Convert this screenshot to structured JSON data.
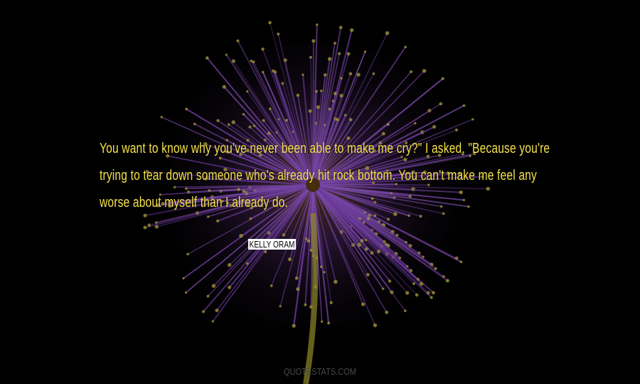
{
  "quote": {
    "text": "You want to know why you've never been able to make me cry?\" I asked. \"Because you're trying to tear down someone who's already hit rock bottom. You can't make me feel any worse about myself than I already do."
  },
  "author": {
    "name": "KELLY ORAM"
  },
  "footer": {
    "site": "QUOTESTATS.COM"
  },
  "colors": {
    "background": "#000000",
    "quote_text": "#f4e14a",
    "flower": "#6a3a9a",
    "stem": "#8f8a2a"
  },
  "background_image": {
    "subject": "purple-flower-icon"
  }
}
